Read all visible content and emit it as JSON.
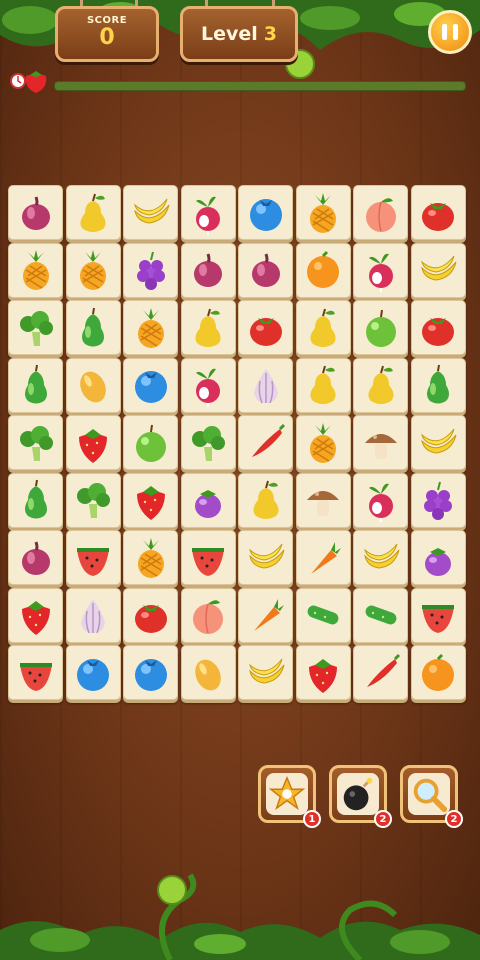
{
  "header": {
    "score_label": "SCORE",
    "score_value": "0",
    "level_label": "Level",
    "level_value": "3",
    "level_progress": 0.0
  },
  "board": {
    "rows": [
      [
        "onion",
        "pear",
        "banana",
        "radish",
        "blueberry",
        "pineapple",
        "peach",
        "tomato"
      ],
      [
        "pineapple",
        "pineapple",
        "grapes",
        "onion",
        "onion",
        "orange",
        "radish",
        "banana"
      ],
      [
        "broccoli",
        "green-pear",
        "pineapple",
        "pear",
        "tomato",
        "pear",
        "green-apple",
        "tomato"
      ],
      [
        "green-pear",
        "mango",
        "blueberry",
        "radish",
        "garlic",
        "pear",
        "pear",
        "green-pear"
      ],
      [
        "broccoli",
        "strawberry",
        "green-apple",
        "broccoli",
        "chili",
        "pineapple",
        "mushroom",
        "banana"
      ],
      [
        "green-pear",
        "broccoli",
        "strawberry",
        "eggplant",
        "pear",
        "mushroom",
        "radish",
        "grapes"
      ],
      [
        "onion",
        "watermelon",
        "pineapple",
        "watermelon",
        "banana",
        "carrot",
        "banana",
        "eggplant"
      ],
      [
        "strawberry",
        "garlic",
        "tomato",
        "peach",
        "carrot",
        "cucumber",
        "cucumber",
        "watermelon"
      ],
      [
        "watermelon",
        "blueberry",
        "blueberry",
        "mango",
        "banana",
        "strawberry",
        "chili",
        "orange"
      ]
    ]
  },
  "boosters": [
    {
      "name": "shuffle",
      "icon": "shuffle-star-icon",
      "count": "1"
    },
    {
      "name": "bomb",
      "icon": "bomb-icon",
      "count": "2"
    },
    {
      "name": "hint",
      "icon": "magnifier-icon",
      "count": "2"
    }
  ],
  "colors": {
    "wood": "#6e3618",
    "tile": "#f6ecd2",
    "accent": "#ffd34a",
    "badge": "#e0302a"
  }
}
